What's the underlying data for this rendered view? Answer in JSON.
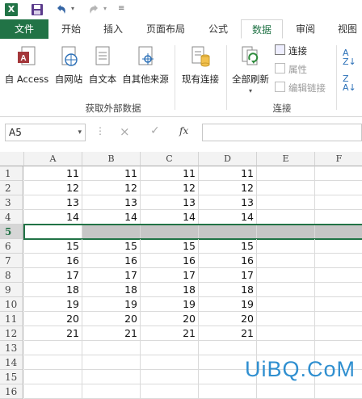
{
  "qat": {
    "app_icon": "excel-icon",
    "save_icon": "save-icon",
    "undo_icon": "undo-icon",
    "redo_icon": "redo-icon",
    "customize_icon": "customize-icon"
  },
  "tabs": [
    {
      "label": "文件"
    },
    {
      "label": "开始"
    },
    {
      "label": "插入"
    },
    {
      "label": "页面布局"
    },
    {
      "label": "公式"
    },
    {
      "label": "数据"
    },
    {
      "label": "审阅"
    },
    {
      "label": "视图"
    }
  ],
  "active_tab": "数据",
  "ribbon": {
    "external": {
      "access": "自 Access",
      "web": "自网站",
      "text": "自文本",
      "other": "自其他来源",
      "existing": "现有连接",
      "group_label": "获取外部数据"
    },
    "connections": {
      "refresh_all": "全部刷新",
      "connections": "连接",
      "properties": "属性",
      "edit_links": "编辑链接",
      "group_label": "连接"
    }
  },
  "formula_bar": {
    "name_box": "A5",
    "cancel": "×",
    "enter": "✓",
    "fx": "fx",
    "value": ""
  },
  "columns": [
    "A",
    "B",
    "C",
    "D",
    "E",
    "F"
  ],
  "rows": [
    {
      "n": "1",
      "cells": [
        "11",
        "11",
        "11",
        "11"
      ]
    },
    {
      "n": "2",
      "cells": [
        "12",
        "12",
        "12",
        "12"
      ]
    },
    {
      "n": "3",
      "cells": [
        "13",
        "13",
        "13",
        "13"
      ]
    },
    {
      "n": "4",
      "cells": [
        "14",
        "14",
        "14",
        "14"
      ]
    },
    {
      "n": "5",
      "cells": [
        "",
        "",
        "",
        ""
      ]
    },
    {
      "n": "6",
      "cells": [
        "15",
        "15",
        "15",
        "15"
      ]
    },
    {
      "n": "7",
      "cells": [
        "16",
        "16",
        "16",
        "16"
      ]
    },
    {
      "n": "8",
      "cells": [
        "17",
        "17",
        "17",
        "17"
      ]
    },
    {
      "n": "9",
      "cells": [
        "18",
        "18",
        "18",
        "18"
      ]
    },
    {
      "n": "10",
      "cells": [
        "19",
        "19",
        "19",
        "19"
      ]
    },
    {
      "n": "11",
      "cells": [
        "20",
        "20",
        "20",
        "20"
      ]
    },
    {
      "n": "12",
      "cells": [
        "21",
        "21",
        "21",
        "21"
      ]
    },
    {
      "n": "13",
      "cells": [
        "",
        "",
        "",
        ""
      ]
    },
    {
      "n": "14",
      "cells": [
        "",
        "",
        "",
        ""
      ]
    },
    {
      "n": "15",
      "cells": [
        "",
        "",
        "",
        ""
      ]
    },
    {
      "n": "16",
      "cells": [
        "",
        "",
        "",
        ""
      ]
    }
  ],
  "selected_row": "5",
  "watermark": "UiBQ.CoM",
  "colors": {
    "accent": "#217346",
    "selection": "#c6c6c6",
    "watermark": "#2f8fd0"
  }
}
